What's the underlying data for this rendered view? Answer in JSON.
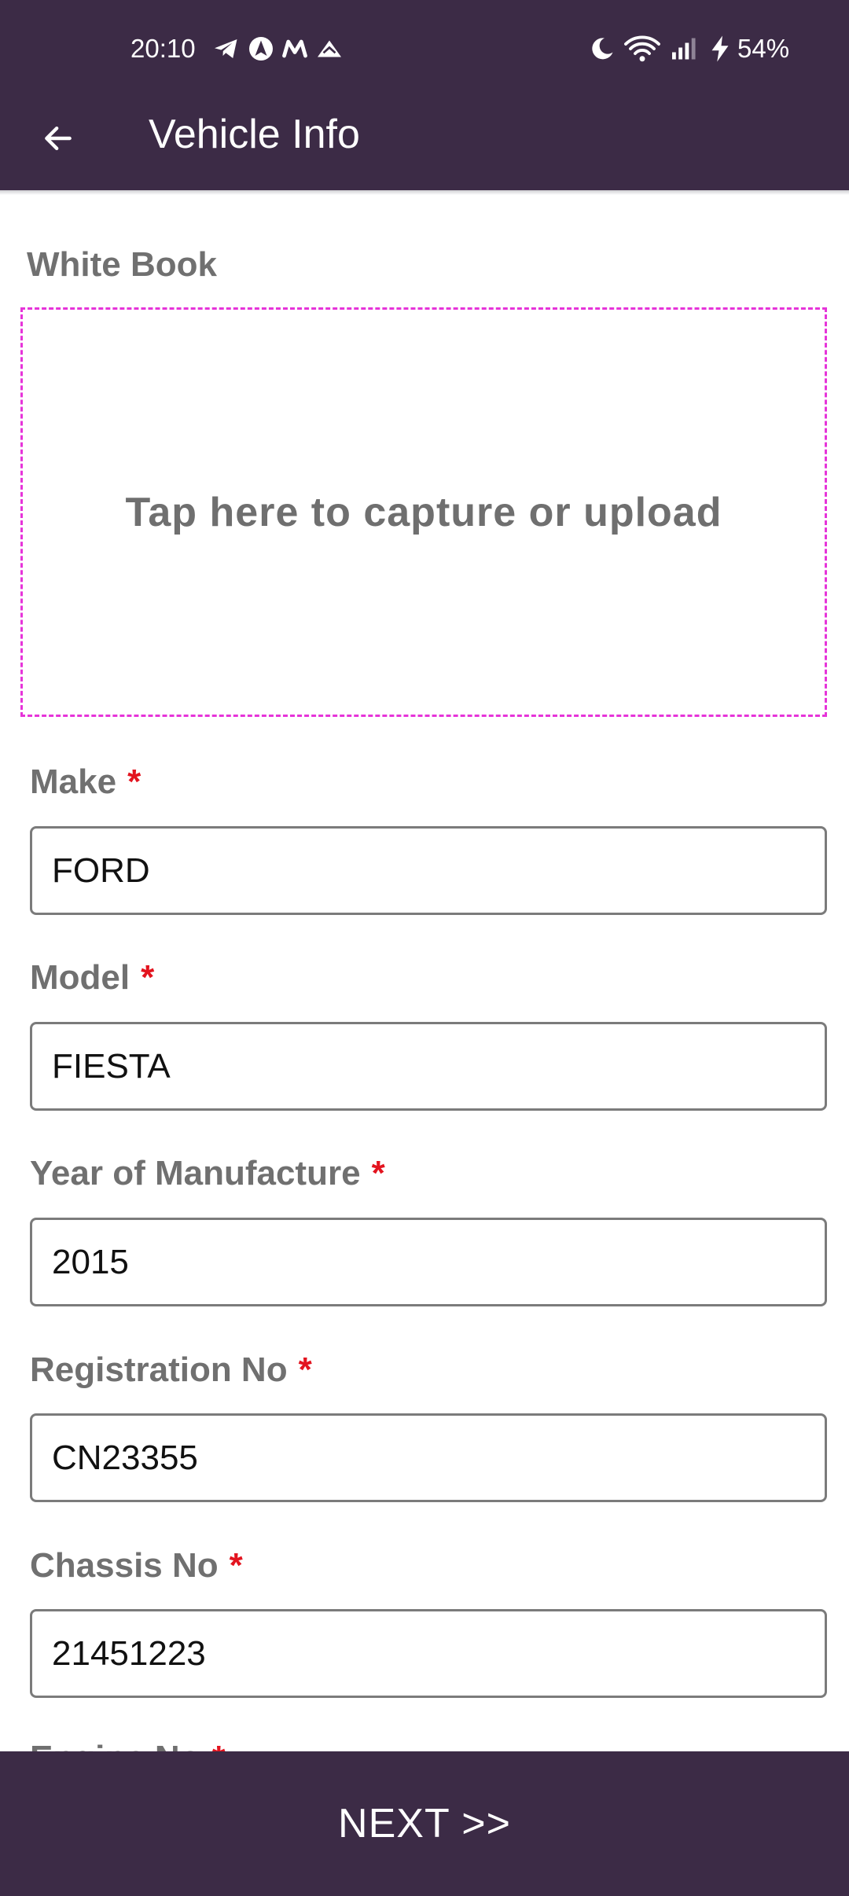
{
  "status_bar": {
    "time": "20:10",
    "battery": "54%",
    "left_icons": [
      "telegram-icon",
      "navigation-icon",
      "meta-icon",
      "cloud-icon"
    ],
    "right_icons": [
      "moon-icon",
      "wifi-icon",
      "signal-icon",
      "charging-icon"
    ]
  },
  "toolbar": {
    "title": "Vehicle Info",
    "back_icon": "arrow-left-icon"
  },
  "white_book": {
    "label": "White Book",
    "upload_text": "Tap here to capture or upload"
  },
  "fields": [
    {
      "label": "Make",
      "value": "FORD",
      "required": true
    },
    {
      "label": "Model",
      "value": "FIESTA",
      "required": true
    },
    {
      "label": "Year of Manufacture",
      "value": "2015",
      "required": true
    },
    {
      "label": "Registration No",
      "value": "CN23355",
      "required": true
    },
    {
      "label": "Chassis No",
      "value": "21451223",
      "required": true
    }
  ],
  "required_marker": "*",
  "next_field_label": "Engine No",
  "footer": {
    "next_label": "NEXT >>"
  },
  "colors": {
    "header_bg": "#3c2b46",
    "upload_border": "#e634d9",
    "label_text": "#707070",
    "required_star": "#e3141f"
  }
}
